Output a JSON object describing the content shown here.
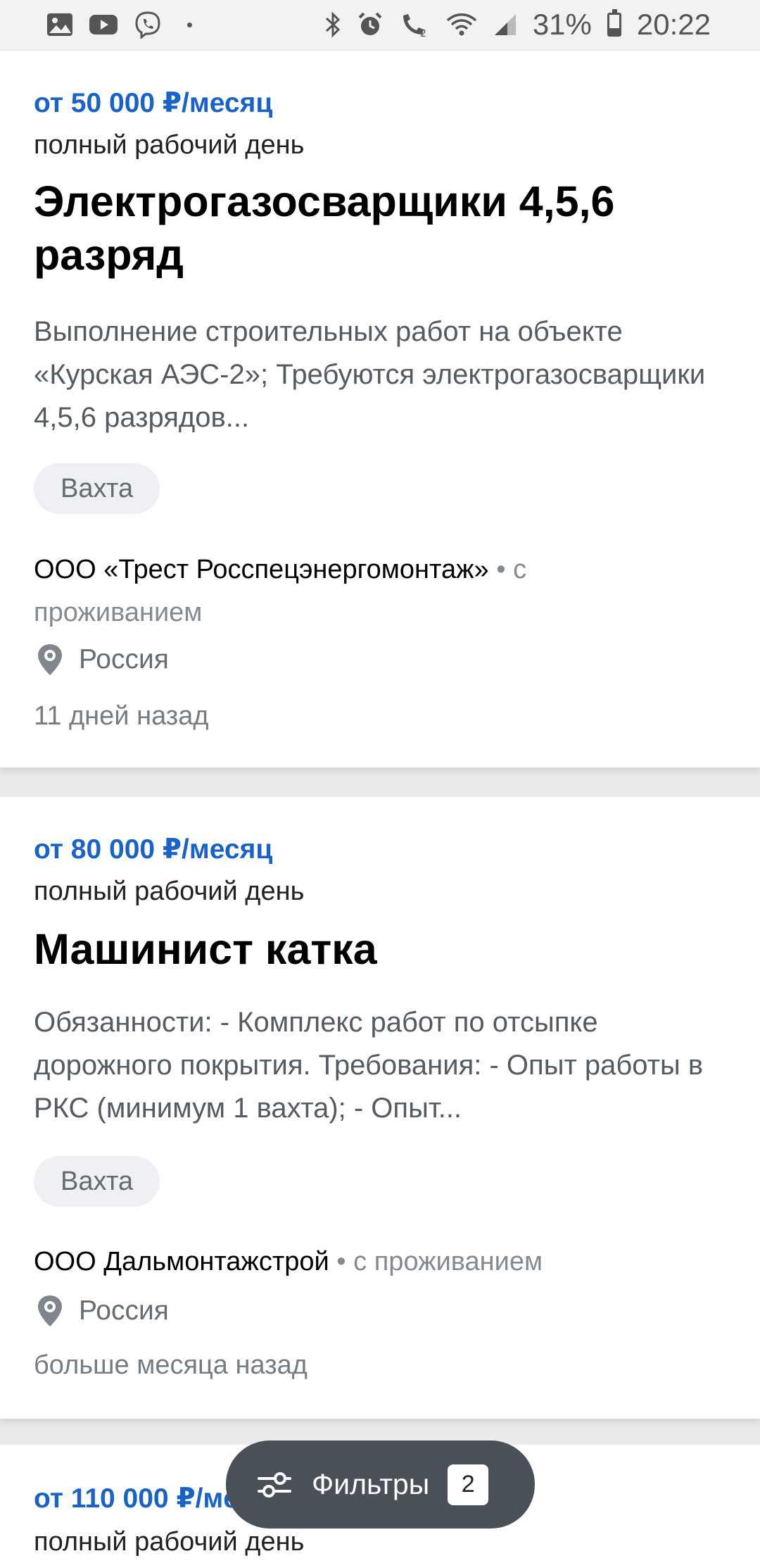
{
  "status_bar": {
    "battery": "31%",
    "time": "20:22",
    "icons": [
      "gallery-icon",
      "youtube-icon",
      "viber-icon",
      "bluetooth-icon",
      "alarm-icon",
      "wifi-call-icon",
      "wifi-icon",
      "signal-icon",
      "battery-icon"
    ]
  },
  "jobs": [
    {
      "salary": "от 50 000 ₽/месяц",
      "schedule": "полный рабочий день",
      "title": "Электрогазосварщики 4,5,6 разряд",
      "description": "Выполнение строительных работ на объекте «Курская АЭС-2»; Требуются электрогазосварщики 4,5,6 разрядов...",
      "tag": "Вахта",
      "company": "ООО «Трест Росспецэнергомонтаж»",
      "company_meta": " • с проживанием",
      "location": "Россия",
      "age": "11 дней назад"
    },
    {
      "salary": "от 80 000 ₽/месяц",
      "schedule": "полный рабочий день",
      "title": "Машинист катка",
      "description": "Обязанности: - Комплекс работ по отсыпке дорожного покрытия. Требования: - Опыт работы в РКС (минимум 1 вахта); - Опыт...",
      "tag": "Вахта",
      "company": "ООО Дальмонтажстрой",
      "company_meta": " • с проживанием",
      "location": "Россия",
      "age": "больше месяца назад"
    },
    {
      "salary": "от 110 000 ₽/месяц",
      "schedule": "полный рабочий день"
    }
  ],
  "filter_button": {
    "label": "Фильтры",
    "count": "2"
  },
  "colors": {
    "salary": "#1a62c6",
    "filter_button_bg": "#4a5057",
    "tag_bg": "#eef0f3"
  }
}
